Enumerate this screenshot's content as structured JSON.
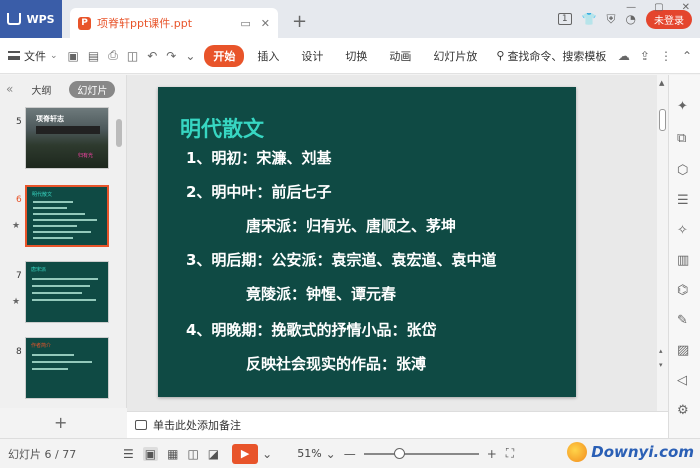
{
  "app": {
    "name": "WPS"
  },
  "doc_tab": {
    "name": "项脊轩ppt课件.ppt",
    "ppt_badge": "P"
  },
  "title_right": {
    "badge": "1",
    "login": "未登录"
  },
  "menubar": {
    "file": "文件",
    "tabs": [
      "开始",
      "插入",
      "设计",
      "切换",
      "动画",
      "幻灯片放"
    ],
    "active_tab": "开始",
    "search": "查找命令、搜索模板"
  },
  "left_panel": {
    "tabs": [
      "大纲",
      "幻灯片"
    ],
    "active_tab": "幻灯片",
    "thumbs": [
      {
        "num": "5",
        "title": "项脊轩志",
        "subtitle": "归有光"
      },
      {
        "num": "6",
        "title": "明代散文"
      },
      {
        "num": "7",
        "title": "唐宋派"
      },
      {
        "num": "8",
        "title": "作者简介"
      }
    ]
  },
  "slide": {
    "title": "明代散文",
    "lines": [
      "1、明初：宋濂、刘基",
      "2、明中叶：前后七子",
      "唐宋派：归有光、唐顺之、茅坤",
      "3、明后期：公安派：袁宗道、袁宏道、袁中道",
      "竟陵派：钟惺、谭元春",
      "4、明晚期：挽歌式的抒情小品：张岱",
      "反映社会现实的作品：张溥"
    ]
  },
  "notes": {
    "placeholder": "单击此处添加备注"
  },
  "status": {
    "slide_count": "幻灯片 6 / 77",
    "zoom": "51%",
    "zoom_fraction": 0.3
  },
  "watermark": {
    "text": "Downyi.com"
  }
}
